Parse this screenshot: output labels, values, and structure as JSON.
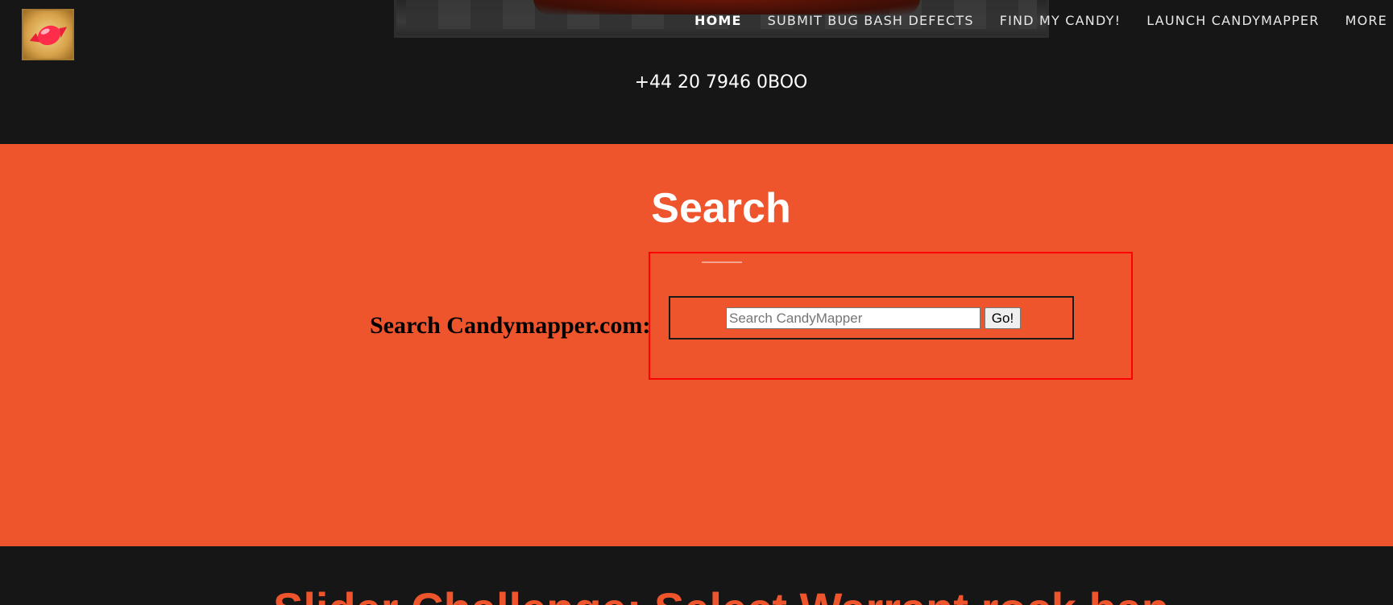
{
  "header": {
    "phone": "+44 20 7946 0BOO",
    "nav": {
      "home": "HOME",
      "submit_bug": "SUBMIT BUG BASH DEFECTS",
      "find_candy": "FIND MY CANDY!",
      "launch": "LAUNCH CANDYMAPPER",
      "more": "MORE"
    }
  },
  "search_section": {
    "title": "Search",
    "label": "Search Candymapper.com:",
    "input_placeholder": "Search CandyMapper",
    "input_value": "",
    "go_label": "Go!"
  },
  "next_section": {
    "title": "Slider Challenge: Select Warrant rock ban"
  },
  "colors": {
    "accent": "#ee552d",
    "dark_bg": "#161616",
    "highlight": "#ff0000"
  },
  "icons": {
    "logo": "candy-icon"
  }
}
